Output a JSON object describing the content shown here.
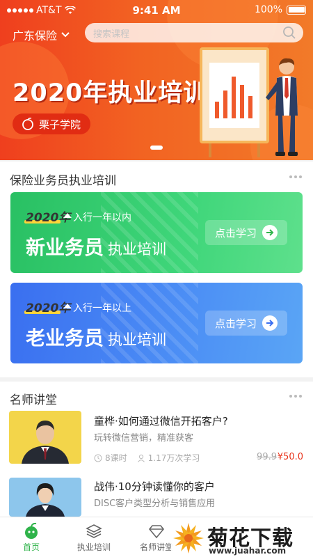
{
  "status_bar": {
    "carrier": "AT&T",
    "time": "9:41 AM",
    "battery": "100%"
  },
  "header": {
    "region": "广东保险",
    "search_placeholder": "搜索课程"
  },
  "banner": {
    "title": "2020年执业培训",
    "brand": "栗子学院"
  },
  "training_section": {
    "title": "保险业务员执业培训",
    "cards": [
      {
        "year": "2020年",
        "subtitle": "入行一年以内",
        "headline": "新业务员",
        "headline_suffix": "执业培训",
        "cta": "点击学习"
      },
      {
        "year": "2020年",
        "subtitle": "入行一年以上",
        "headline": "老业务员",
        "headline_suffix": "执业培训",
        "cta": "点击学习"
      }
    ]
  },
  "lecture_section": {
    "title": "名师讲堂",
    "courses": [
      {
        "title": "童桦·如何通过微信开拓客户?",
        "desc": "玩转微信营销，精准获客",
        "lessons": "8课时",
        "views": "1.17万次学习",
        "price_old": "99.9",
        "price": "¥50.0"
      },
      {
        "title": "战伟·10分钟读懂你的客户",
        "desc": "DISC客户类型分析与销售应用"
      }
    ]
  },
  "tabbar": {
    "tabs": [
      {
        "label": "首页"
      },
      {
        "label": "执业培训"
      },
      {
        "label": "名师讲堂"
      }
    ]
  },
  "watermark": {
    "text": "菊花下载网",
    "url": "www.juahar.com"
  },
  "colors": {
    "accent_green": "#2fb34a",
    "banner_orange": "#f26322",
    "price_red": "#e8331b"
  }
}
